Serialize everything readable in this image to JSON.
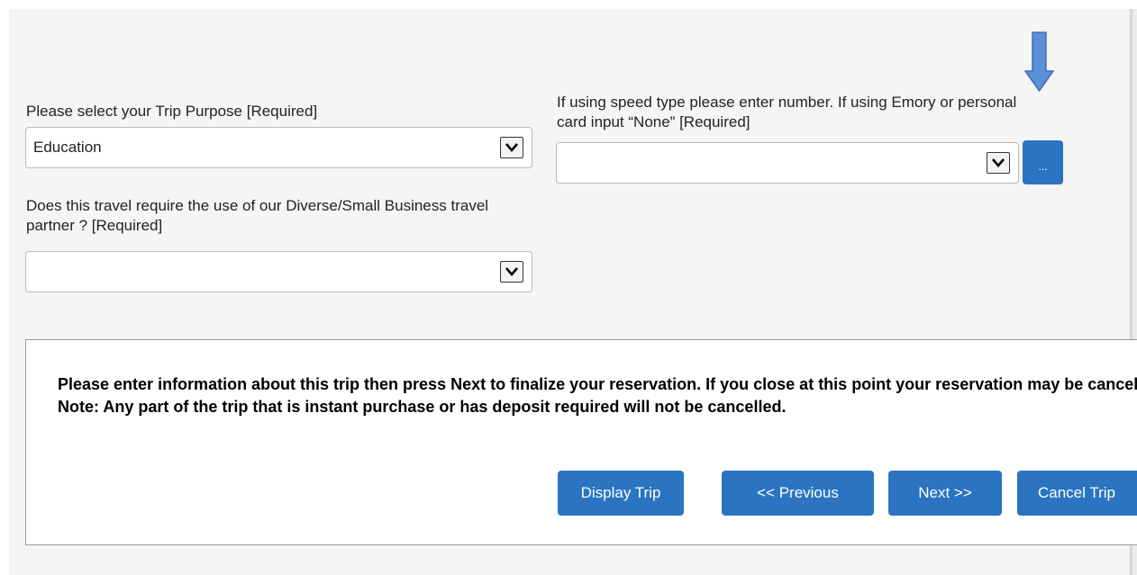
{
  "form": {
    "trip_purpose": {
      "label": "Please select your Trip Purpose [Required]",
      "value": "Education"
    },
    "diverse_partner": {
      "label": "Does this travel require the use of our Diverse/Small Business travel partner ? [Required]",
      "value": ""
    },
    "speed_type": {
      "label": "If using speed type please enter number. If using Emory or personal card input “None” [Required]",
      "value": "",
      "lookup_label": "..."
    }
  },
  "notice": {
    "text": "Please enter information about this trip then press Next to finalize your reservation. If you close at this point your reservation may be cancelled. Note: Any part of the trip that is instant purchase or has deposit required will not be cancelled."
  },
  "buttons": {
    "display_trip": "Display Trip",
    "previous": "<< Previous",
    "next": "Next >>",
    "cancel_trip": "Cancel Trip"
  },
  "icons": {
    "select_arrow": "chevron-down-icon",
    "pointer": "arrow-down-icon"
  },
  "colors": {
    "button": "#2a74c1",
    "pointer_arrow": "#5b8fd6"
  }
}
